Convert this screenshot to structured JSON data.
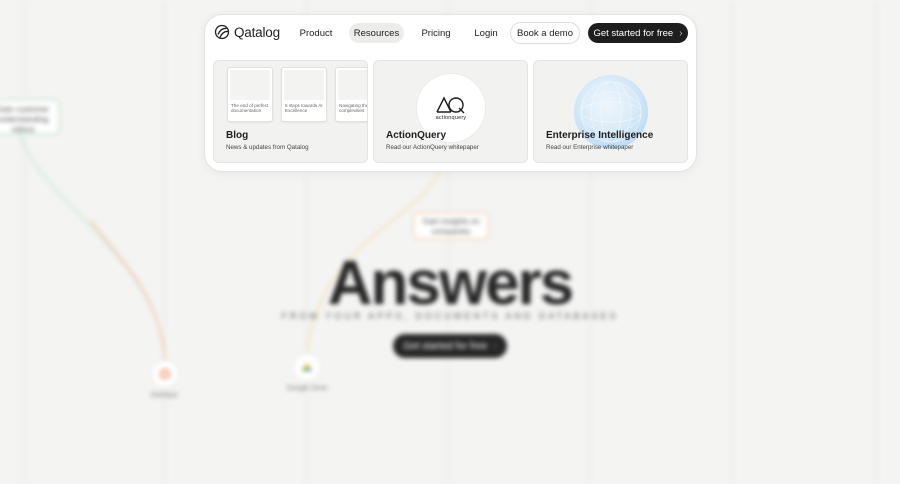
{
  "navbar": {
    "logo_text": "Qatalog",
    "items": {
      "product": "Product",
      "resources": "Resources",
      "pricing": "Pricing",
      "login": "Login",
      "demo": "Book a demo",
      "cta": "Get started for free"
    },
    "active_item": "Resources"
  },
  "resources_menu": {
    "blog": {
      "title": "Blog",
      "desc": "News & updates from Qatalog",
      "cards": [
        "The end of perfect documentation",
        "5 steps towards AI Excellence",
        "Navigating the complexities"
      ]
    },
    "actionquery": {
      "title": "ActionQuery",
      "desc": "Read our ActionQuery whitepaper",
      "wordmark": "actionquery"
    },
    "enterprise": {
      "title": "Enterprise Intelligence",
      "desc": "Read our Enterprise whitepaper"
    }
  },
  "background": {
    "chip_green": "Gain customer understanding videos",
    "chip_orange": "Gain insights on companies",
    "headline": "Answers",
    "subline": "FROM YOUR APPS, DOCUMENTS AND DATABASES",
    "cta": "Get started for free",
    "node_hubspot": "HubSpot",
    "node_drive": "Google Drive"
  },
  "colors": {
    "accent_dark": "#1e1e1e",
    "resources_highlight": "#ececeb",
    "panel_bg": "#f2f2f1",
    "sphere_blue": "#9fcdf2",
    "curve_green": "#cfe9d6",
    "curve_orange": "#f7c9b0"
  }
}
